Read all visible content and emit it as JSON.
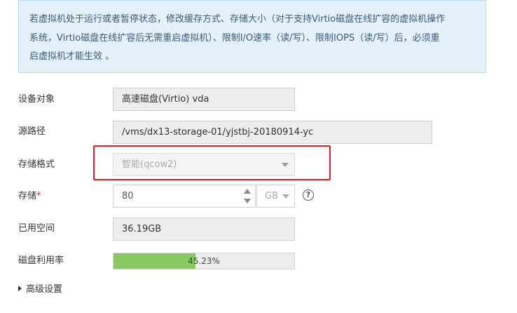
{
  "notice": {
    "line1": "若虚拟机处于运行或者暂停状态，修改缓存方式、存储大小（对于支持Virtio磁盘在线扩容的虚拟机操作",
    "line2": "系统，Virtio磁盘在线扩容后无需重启虚拟机）、限制I/O速率（读/写）、限制IOPS（读/写）后，必须重",
    "line3": "启虚拟机才能生效 。"
  },
  "form": {
    "device": {
      "label": "设备对象",
      "value": "高速磁盘(Virtio) vda"
    },
    "source_path": {
      "label": "源路径",
      "value": "/vms/dx13-storage-01/yjstbj-20180914-yc"
    },
    "storage_format": {
      "label": "存储格式",
      "value": "智能(qcow2)"
    },
    "storage": {
      "label": "存储",
      "required_mark": "*",
      "value": "80",
      "unit": "GB",
      "help": "?"
    },
    "used_space": {
      "label": "已用空间",
      "value": "36.19GB"
    },
    "disk_usage": {
      "label": "磁盘利用率",
      "percent": 45.23,
      "text": "45.23%"
    },
    "advanced": {
      "label": "高级设置"
    }
  },
  "colors": {
    "progress_fill": "#88c963",
    "highlight_border": "#e02020",
    "notice_bg": "#e4f1fa"
  },
  "icons": {
    "format_caret": "chevron-down-icon",
    "help": "question-circle-icon",
    "advanced": "caret-right-icon"
  }
}
